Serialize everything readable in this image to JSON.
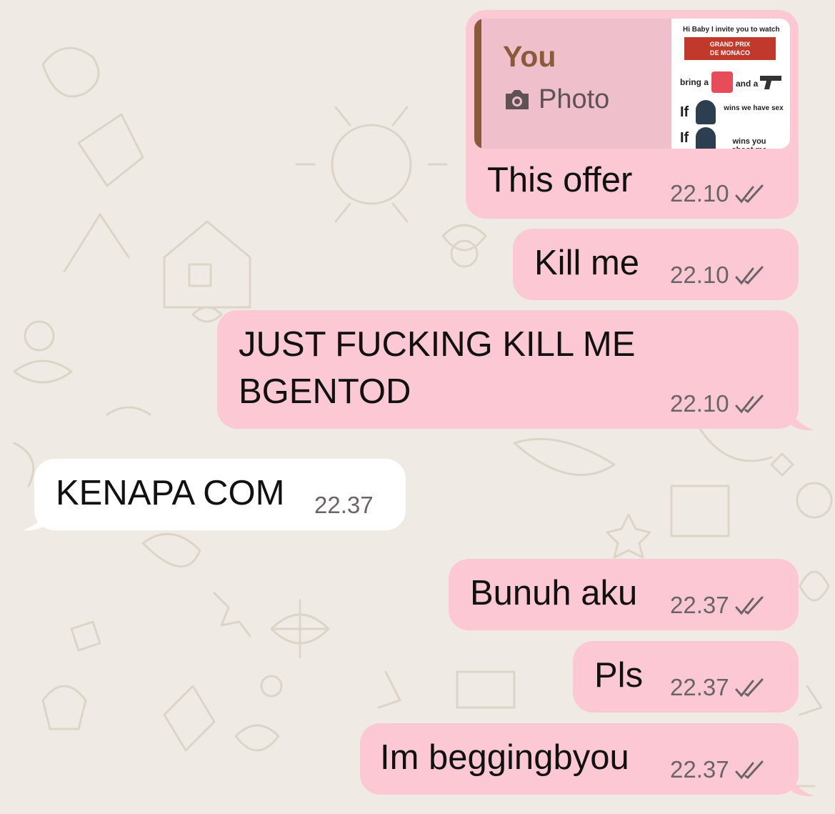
{
  "chat": {
    "messages": [
      {
        "direction": "out",
        "reply_to": {
          "author": "You",
          "type_label": "Photo",
          "type_icon": "camera-icon"
        },
        "thumbnail_text": {
          "line1": "Hi Baby I invite you to watch",
          "banner_top": "GRAND PRIX",
          "banner_bottom": "DE MONACO",
          "bring": "bring a",
          "and": "and a",
          "if1": "If",
          "wins_sex": "wins we have sex",
          "if2": "If",
          "wins_shoot": "wins you shoot me"
        },
        "text": "This offer",
        "time": "22.10",
        "status": "read"
      },
      {
        "direction": "out",
        "text": "Kill me",
        "time": "22.10",
        "status": "read"
      },
      {
        "direction": "out",
        "text_line1": "JUST FUCKING KILL ME",
        "text_line2": "BGENTOD",
        "time": "22.10",
        "status": "read"
      },
      {
        "direction": "in",
        "text": "KENAPA COM",
        "time": "22.37"
      },
      {
        "direction": "out",
        "text": "Bunuh aku",
        "time": "22.37",
        "status": "read"
      },
      {
        "direction": "out",
        "text": "Pls",
        "time": "22.37",
        "status": "read"
      },
      {
        "direction": "out",
        "text": "Im beggingbyou",
        "time": "22.37",
        "status": "read"
      }
    ]
  },
  "colors": {
    "outgoing_bubble": "#fbc8d4",
    "incoming_bubble": "#ffffff",
    "background": "#efebe4",
    "quote_accent": "#8a5a3a"
  }
}
